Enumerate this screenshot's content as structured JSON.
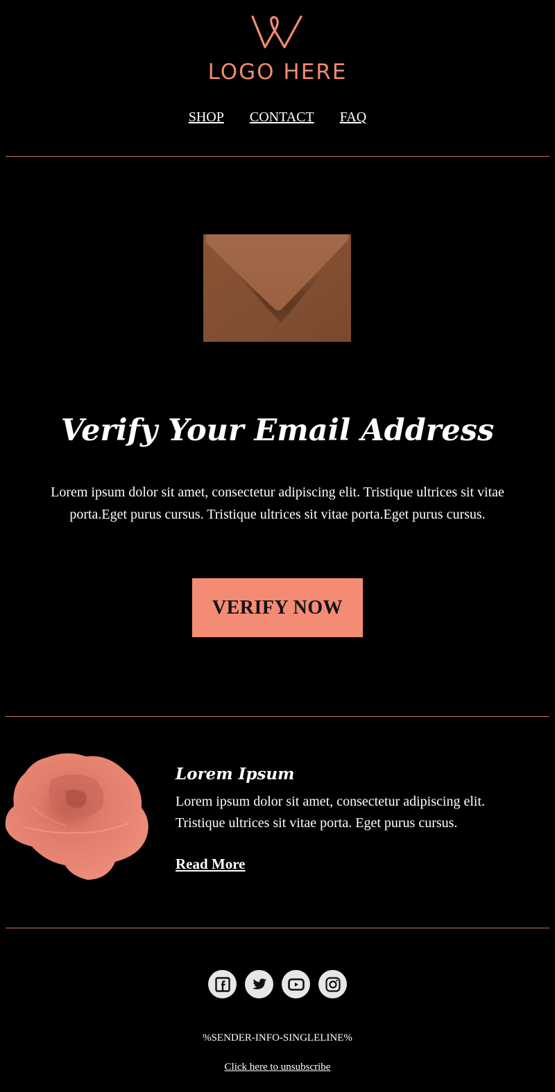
{
  "brand": {
    "logo_text": "LOGO HERE",
    "accent_color": "#f08a72",
    "button_color": "#f48b74",
    "divider_color": "#c8705e"
  },
  "nav": {
    "items": [
      {
        "label": "SHOP"
      },
      {
        "label": "CONTACT"
      },
      {
        "label": "FAQ"
      }
    ]
  },
  "hero": {
    "image": "envelope-image",
    "title": "Verify Your Email Address",
    "body": "Lorem ipsum dolor sit amet, consectetur adipiscing elit. Tristique ultrices sit vitae porta.Eget purus cursus.  Tristique ultrices sit vitae porta.Eget purus cursus.",
    "cta_label": "VERIFY NOW"
  },
  "feature": {
    "image": "rose-image",
    "title": "Lorem Ipsum",
    "body": "Lorem ipsum dolor sit amet, consectetur adipiscing elit. Tristique ultrices sit vitae porta. Eget purus cursus.",
    "link_label": "Read More"
  },
  "footer": {
    "social": [
      {
        "name": "facebook-icon"
      },
      {
        "name": "twitter-icon"
      },
      {
        "name": "youtube-icon"
      },
      {
        "name": "instagram-icon"
      }
    ],
    "sender_info": "%SENDER-INFO-SINGLELINE%",
    "unsubscribe_label": "Click here to unsubscribe"
  }
}
